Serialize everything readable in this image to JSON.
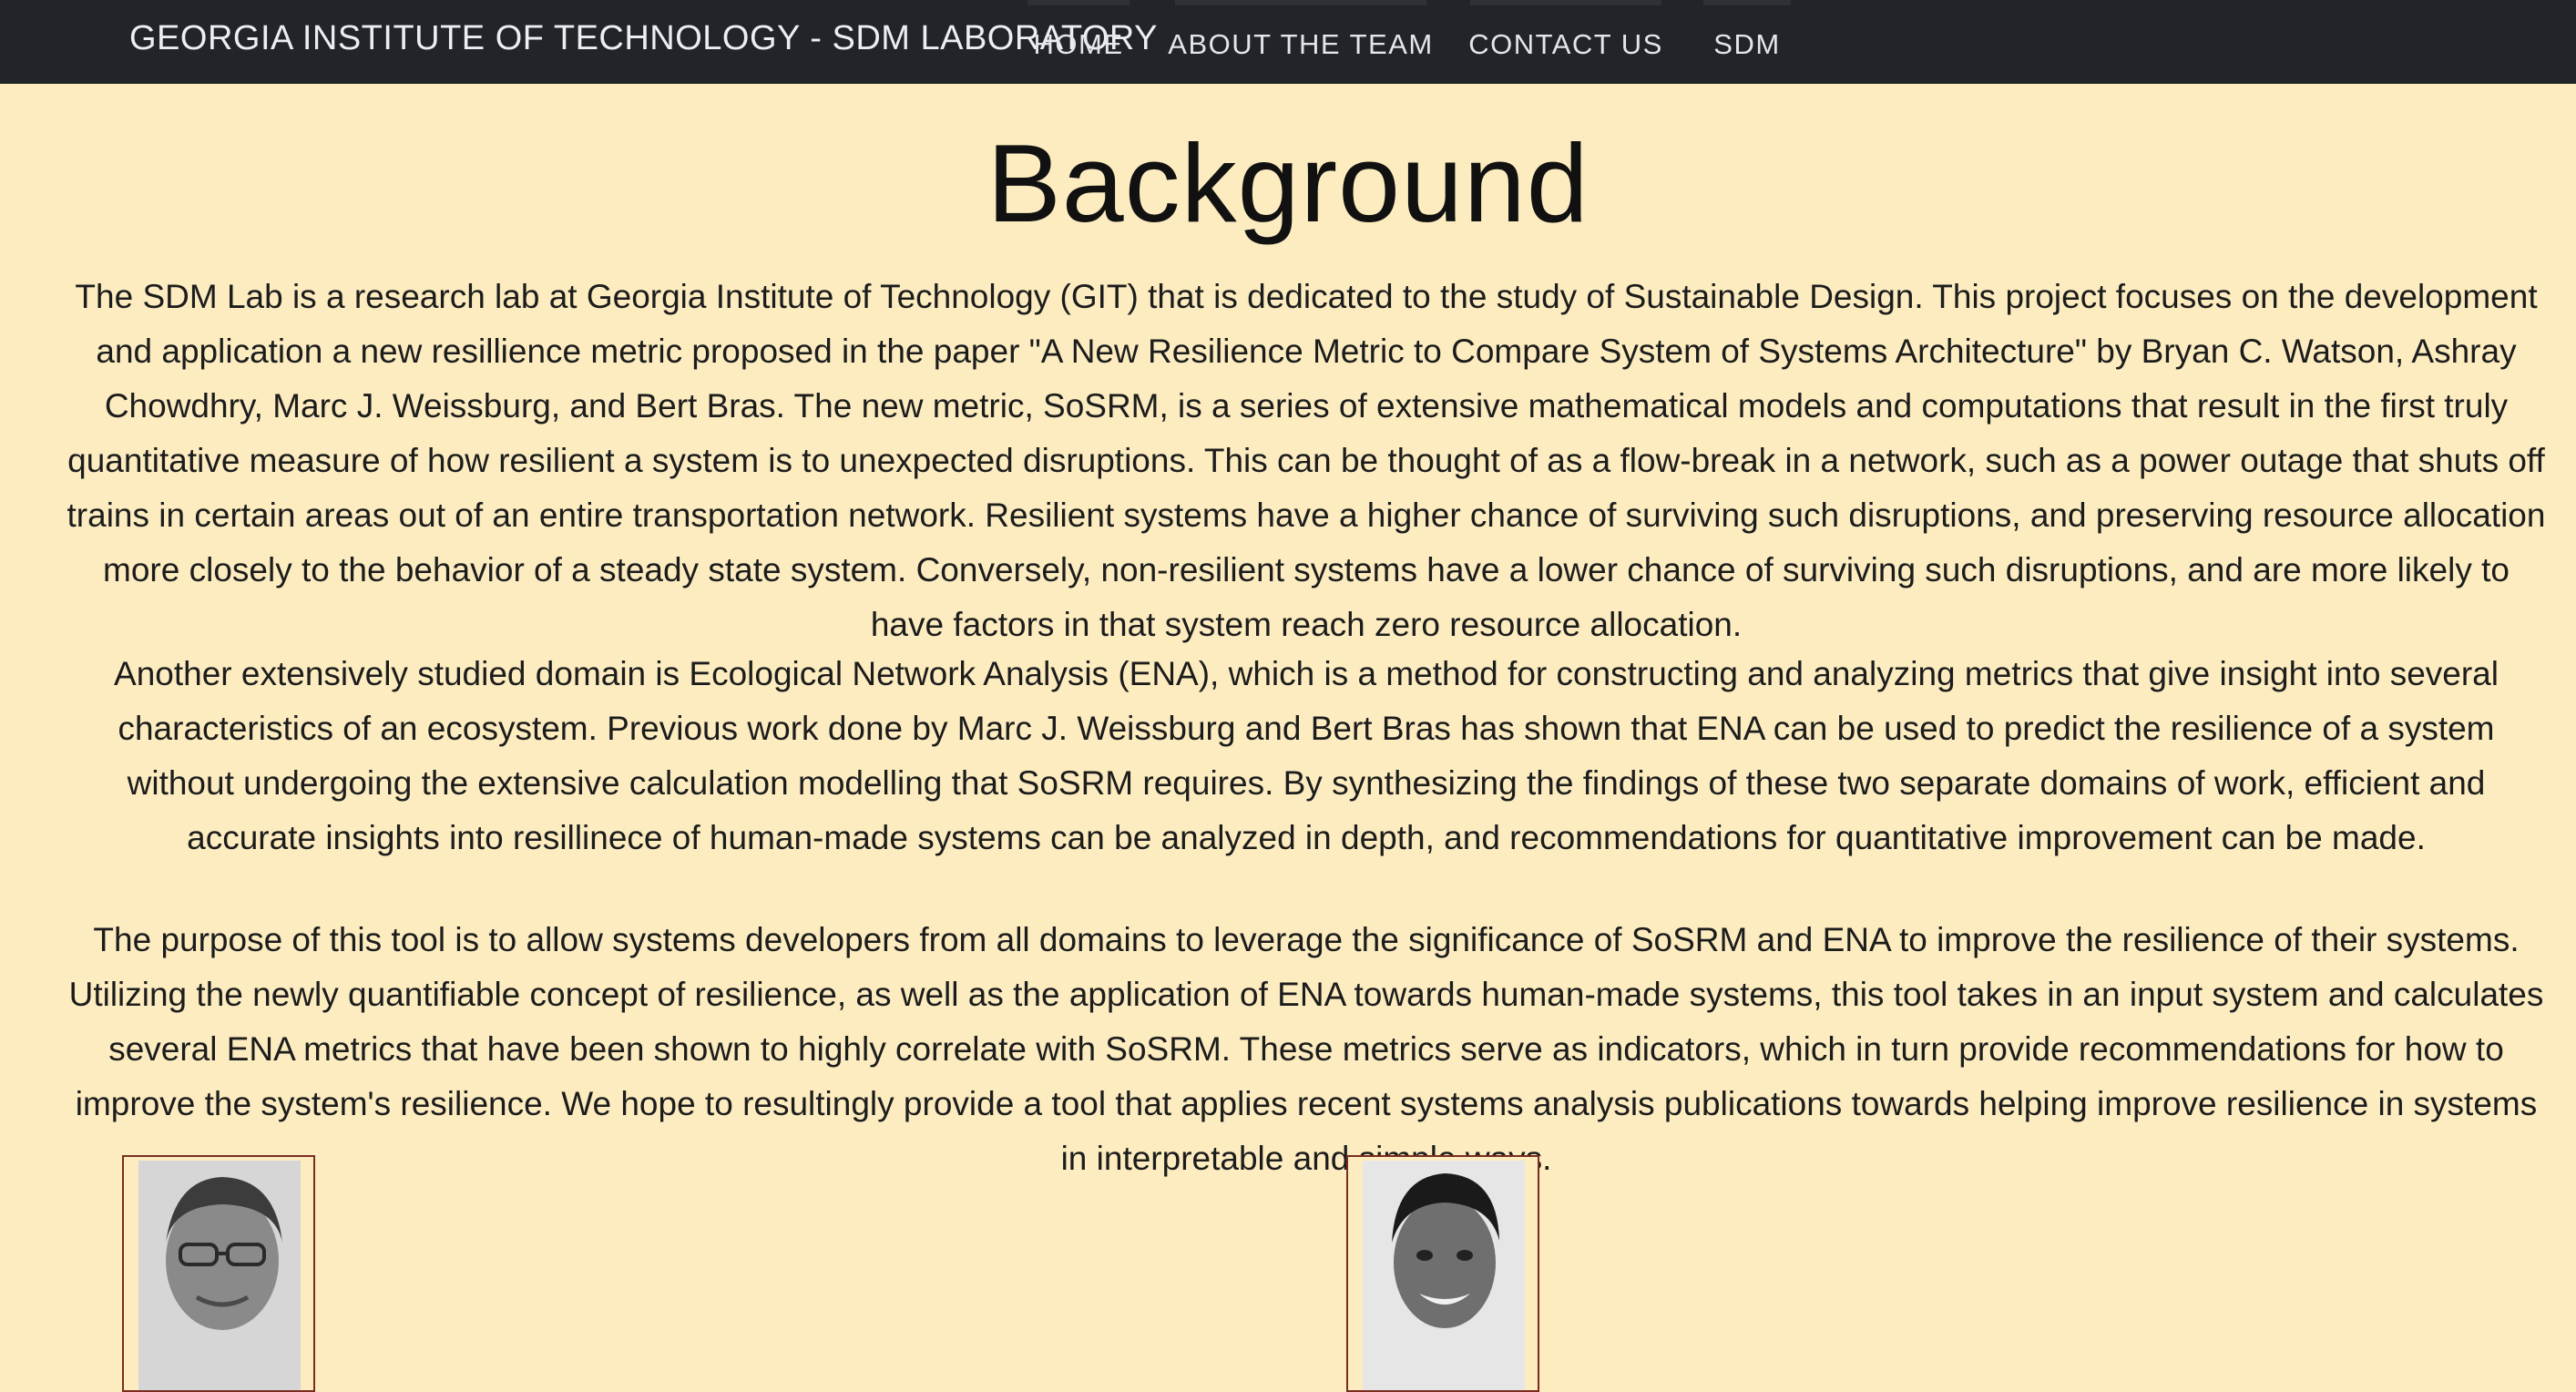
{
  "navbar": {
    "brand": "GEORGIA INSTITUTE OF TECHNOLOGY - SDM LABORATORY",
    "items": [
      {
        "label": "HOME"
      },
      {
        "label": "ABOUT THE TEAM"
      },
      {
        "label": "CONTACT US"
      },
      {
        "label": "SDM"
      }
    ]
  },
  "main": {
    "title": "Background",
    "paragraphs": [
      "The SDM Lab is a research lab at Georgia Institute of Technology (GIT) that is dedicated to the study of Sustainable Design. This project focuses on the development and application a new resillience metric proposed in the paper \"A New Resilience Metric to Compare System of Systems Architecture\" by Bryan C. Watson, Ashray Chowdhry, Marc J. Weissburg, and Bert Bras. The new metric, SoSRM, is a series of extensive mathematical models and computations that result in the first truly quantitative measure of how resilient a system is to unexpected disruptions. This can be thought of as a flow-break in a network, such as a power outage that shuts off trains in certain areas out of an entire transportation network. Resilient systems have a higher chance of surviving such disruptions, and preserving resource allocation more closely to the behavior of a steady state system. Conversely, non-resilient systems have a lower chance of surviving such disruptions, and are more likely to have factors in that system reach zero resource allocation.",
      "Another extensively studied domain is Ecological Network Analysis (ENA), which is a method for constructing and analyzing metrics that give insight into several characteristics of an ecosystem. Previous work done by Marc J. Weissburg and Bert Bras has shown that ENA can be used to predict the resilience of a system without undergoing the extensive calculation modelling that SoSRM requires. By synthesizing the findings of these two separate domains of work, efficient and accurate insights into resillinece of human-made systems can be analyzed in depth, and recommendations for quantitative improvement can be made.",
      "The purpose of this tool is to allow systems developers from all domains to leverage the significance of SoSRM and ENA to improve the resilience of their systems. Utilizing the newly quantifiable concept of resilience, as well as the application of ENA towards human-made systems, this tool takes in an input system and calculates several ENA metrics that have been shown to highly correlate with SoSRM. These metrics serve as indicators, which in turn provide recommendations for how to improve the system's resilience. We hope to resultingly provide a tool that applies recent systems analysis publications towards helping improve resilience in systems in interpretable and simple ways."
    ]
  },
  "colors": {
    "navbar_bg": "#212428",
    "page_bg": "#fcecc0",
    "photo_border": "#7a2d1f"
  }
}
